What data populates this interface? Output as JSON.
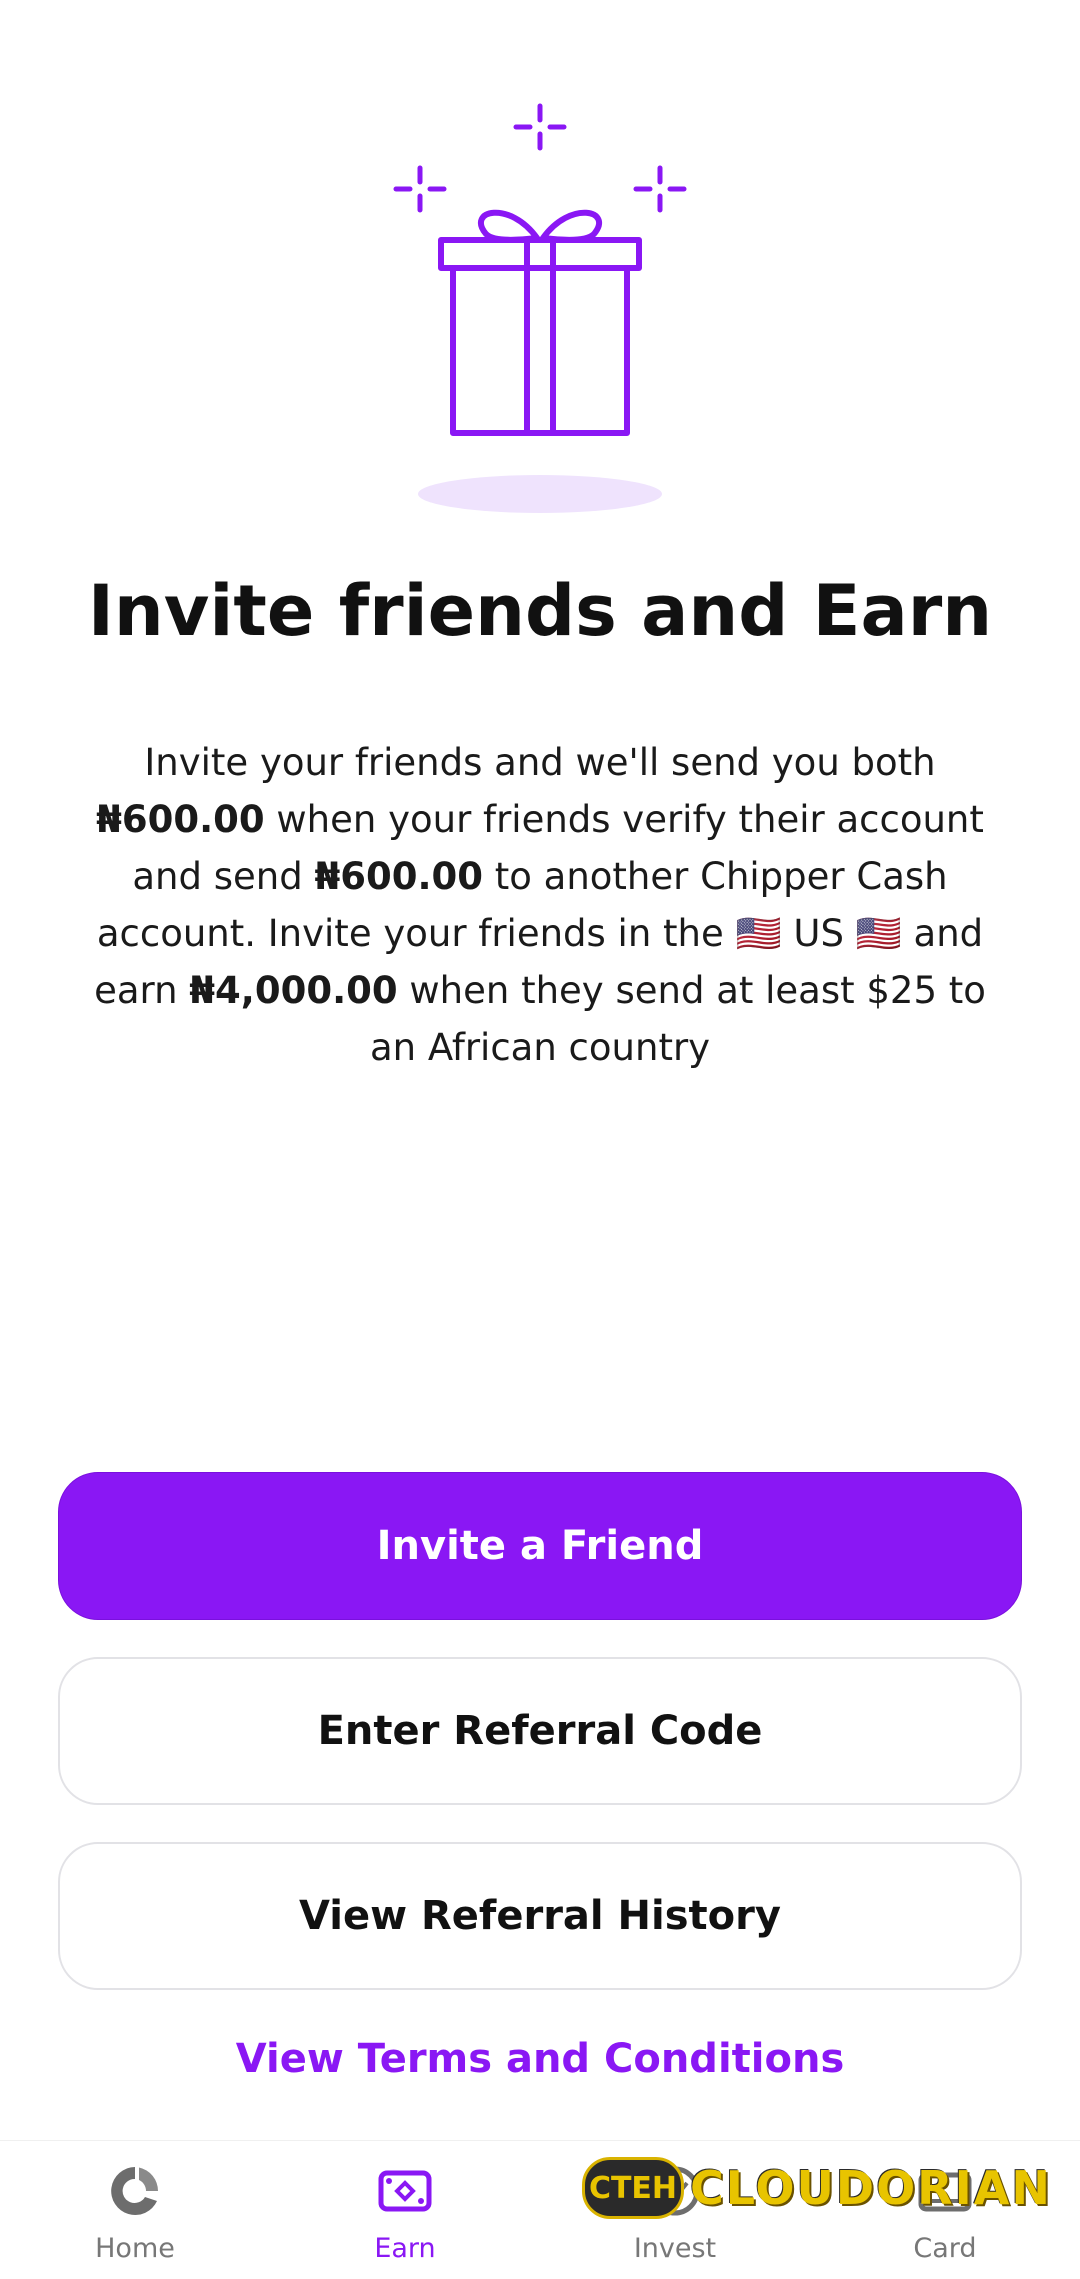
{
  "colors": {
    "accent": "#8a17f4",
    "gift_shadow": "#efe3fd"
  },
  "icons": {
    "hero": "gift-icon",
    "sparkles": "sparkle-icon"
  },
  "main": {
    "title": "Invite friends and Earn",
    "description": {
      "p1": "Invite your friends and we'll send you both ",
      "amount1": "₦600.00",
      "p2": " when your friends verify their account and send ",
      "amount2": "₦600.00",
      "p3": " to another Chipper Cash account. Invite your friends in the 🇺🇸 US 🇺🇸 and earn ",
      "amount3": "₦4,000.00",
      "p4": " when they send at least $25 to an African country"
    }
  },
  "actions": {
    "invite": "Invite a Friend",
    "enter_code": "Enter Referral Code",
    "history": "View Referral History",
    "terms": "View Terms and Conditions"
  },
  "nav": {
    "items": [
      {
        "label": "Home",
        "icon": "home-icon"
      },
      {
        "label": "Earn",
        "icon": "earn-icon",
        "active": true
      },
      {
        "label": "Invest",
        "icon": "invest-icon"
      },
      {
        "label": "Card",
        "icon": "card-icon"
      }
    ]
  },
  "watermark": {
    "badge": "CTEH",
    "text": "CLOUDORIAN"
  }
}
